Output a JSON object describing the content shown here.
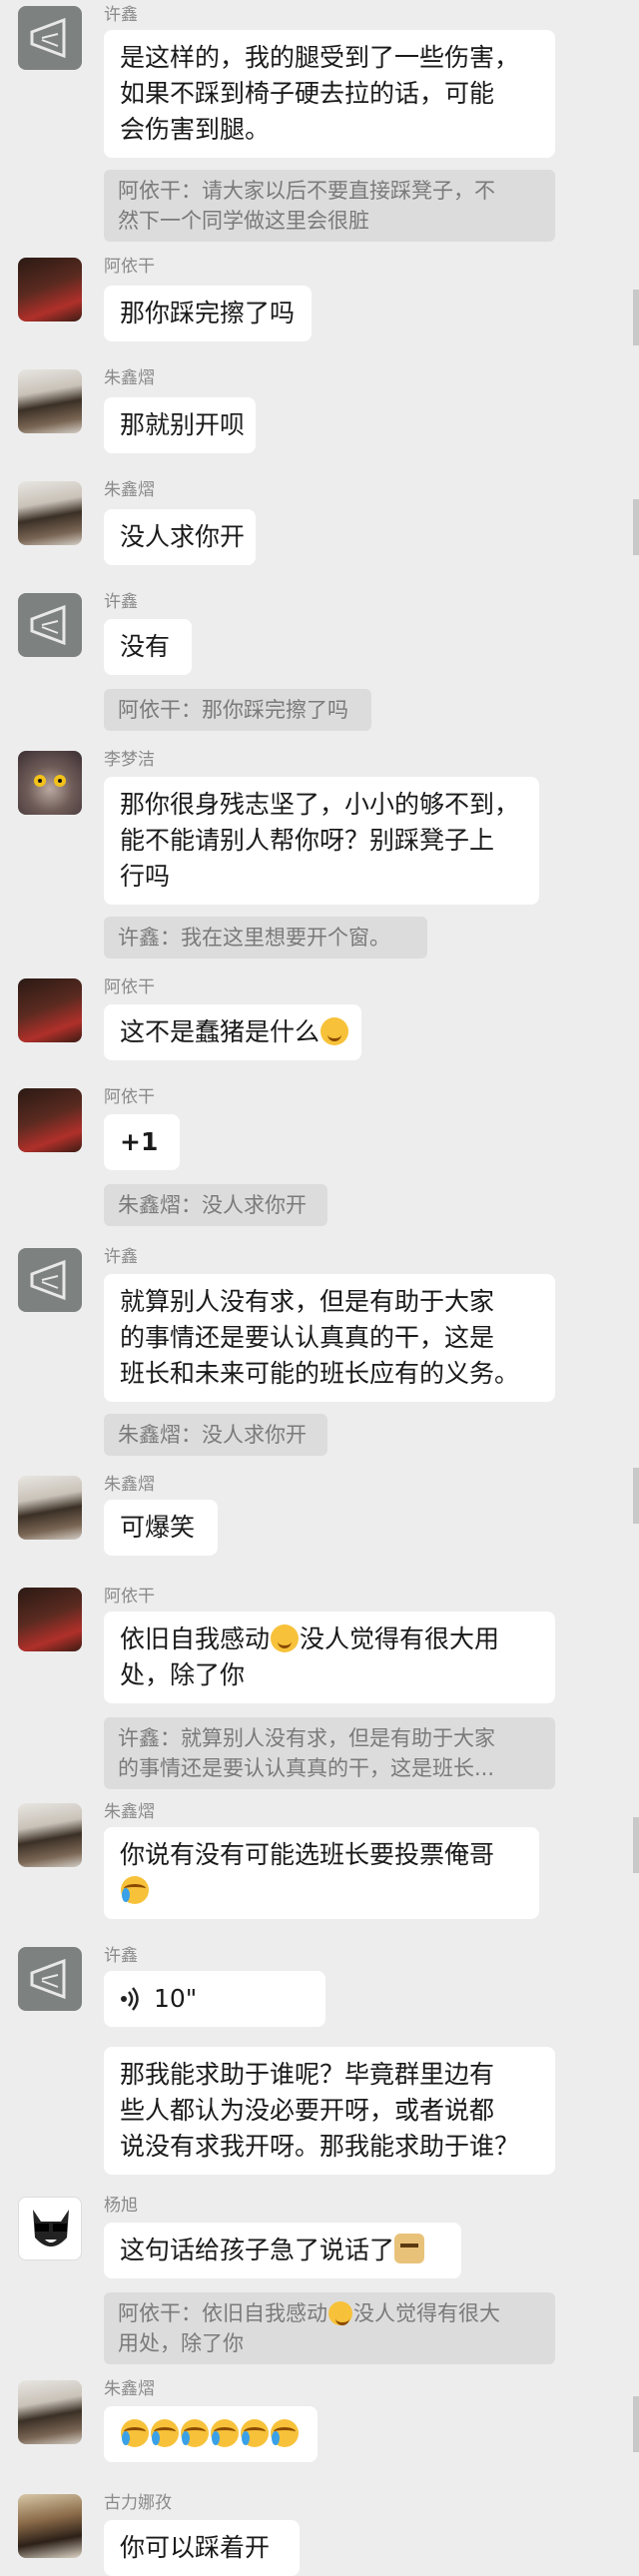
{
  "messages": [
    {
      "name": "许鑫",
      "lines": [
        "是这样的，我的腿受到了一些伤害，",
        "如果不踩到椅子硬去拉的话，可能",
        "会伤害到腿。"
      ],
      "quote": [
        "阿依干：请大家以后不要直接踩凳子，不",
        "然下一个同学做这里会很脏"
      ]
    },
    {
      "name": "阿依干",
      "lines": [
        "那你踩完擦了吗"
      ]
    },
    {
      "name": "朱鑫熠",
      "lines": [
        "那就别开呗"
      ]
    },
    {
      "name": "朱鑫熠",
      "lines": [
        "没人求你开"
      ]
    },
    {
      "name": "许鑫",
      "lines": [
        "没有"
      ],
      "quote": [
        "阿依干：那你踩完擦了吗"
      ]
    },
    {
      "name": "李梦洁",
      "lines": [
        "那你很身残志坚了，小小的够不到，",
        "能不能请别人帮你呀？别踩凳子上",
        "行吗"
      ],
      "quote": [
        "许鑫：我在这里想要开个窗。"
      ]
    },
    {
      "name": "阿依干",
      "lines": [
        "这不是蠢猪是什么"
      ]
    },
    {
      "name": "阿依干",
      "lines": [
        "+1"
      ],
      "quote": [
        "朱鑫熠：没人求你开"
      ]
    },
    {
      "name": "许鑫",
      "lines": [
        "就算别人没有求，但是有助于大家",
        "的事情还是要认认真真的干，这是",
        "班长和未来可能的班长应有的义务。"
      ],
      "quote": [
        "朱鑫熠：没人求你开"
      ]
    },
    {
      "name": "朱鑫熠",
      "lines": [
        "可爆笑"
      ]
    },
    {
      "name": "阿依干",
      "lines": [
        "依旧自我感动",
        "没人觉得有很大用",
        "处，除了你"
      ],
      "quote": [
        "许鑫：就算别人没有求，但是有助于大家",
        "的事情还是要认认真真的干，这是班长..."
      ]
    },
    {
      "name": "朱鑫熠",
      "lines": [
        "你说有没有可能选班长要投票俺哥"
      ]
    },
    {
      "name": "许鑫",
      "voice": "10\"",
      "lines": [
        "那我能求助于谁呢？毕竟群里边有",
        "些人都认为没必要开呀，或者说都",
        "说没有求我开呀。那我能求助于谁？"
      ]
    },
    {
      "name": "杨旭",
      "lines": [
        "这句话给孩子急了说话了"
      ],
      "quote": [
        "阿依干：依旧自我感动",
        "没人觉得有很大",
        "用处，除了你"
      ]
    },
    {
      "name": "朱鑫熠",
      "lines": [
        ""
      ]
    },
    {
      "name": "古力娜孜",
      "lines": [
        "你可以踩着开"
      ]
    }
  ],
  "colors": {
    "background": "#ededed",
    "bubble": "#ffffff",
    "quote": "#dcdcdc",
    "name": "#8a8a8a"
  }
}
